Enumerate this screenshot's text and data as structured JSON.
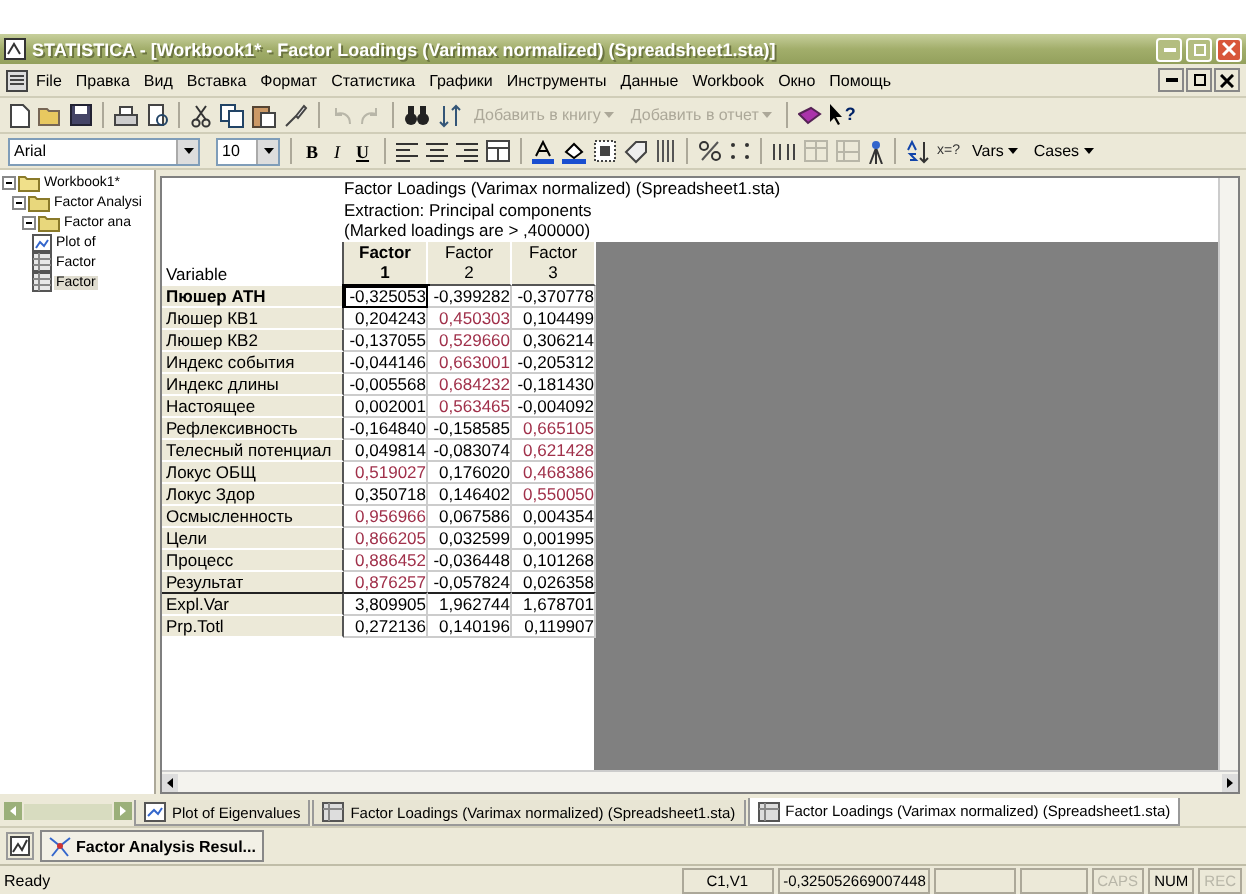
{
  "window": {
    "title": "STATISTICA - [Workbook1* - Factor Loadings (Varimax normalized) (Spreadsheet1.sta)]"
  },
  "menu": [
    "File",
    "Правка",
    "Вид",
    "Вставка",
    "Формат",
    "Статистика",
    "Графики",
    "Инструменты",
    "Данные",
    "Workbook",
    "Окно",
    "Помощь"
  ],
  "toolbar": {
    "undo": {
      "disabled": true
    },
    "redo": {
      "disabled": true
    },
    "add_to_workbook": {
      "label": "Добавить в книгу",
      "disabled": true
    },
    "add_to_report": {
      "label": "Добавить в отчет",
      "disabled": true
    },
    "help_mark": "?"
  },
  "format_bar": {
    "font": "Arial",
    "size": "10",
    "bold": "B",
    "italic": "I",
    "underline": "U",
    "x_label": "x=?",
    "vars": "Vars",
    "cases": "Cases"
  },
  "tree": [
    {
      "label": "Workbook1*",
      "expanded": true,
      "kind": "workbook",
      "selected": false,
      "children": [
        {
          "label": "Factor Analysi",
          "expanded": true,
          "kind": "folder",
          "selected": false,
          "children": [
            {
              "label": "Factor ana",
              "expanded": true,
              "kind": "folder",
              "selected": false,
              "children": [
                {
                  "label": "Plot of",
                  "kind": "graph",
                  "selected": false
                },
                {
                  "label": "Factor",
                  "kind": "sheet",
                  "selected": false
                },
                {
                  "label": "Factor",
                  "kind": "sheet",
                  "selected": true
                }
              ]
            }
          ]
        }
      ]
    }
  ],
  "spreadsheet": {
    "title_lines": [
      "Factor Loadings (Varimax normalized) (Spreadsheet1.sta)",
      "Extraction: Principal components",
      "(Marked loadings are > ,400000)"
    ],
    "row_header_title": "Variable",
    "columns": [
      {
        "name": "Factor",
        "number": "1",
        "selected": true
      },
      {
        "name": "Factor",
        "number": "2",
        "selected": false
      },
      {
        "name": "Factor",
        "number": "3",
        "selected": false
      }
    ],
    "rows": [
      {
        "label": "Пюшер АТН",
        "kind": "data",
        "selected": true,
        "cells": [
          {
            "value": "-0,325053",
            "marked": false
          },
          {
            "value": "-0,399282",
            "marked": false
          },
          {
            "value": "-0,370778",
            "marked": false
          }
        ]
      },
      {
        "label": "Люшер КВ1",
        "kind": "data",
        "selected": false,
        "cells": [
          {
            "value": "0,204243",
            "marked": false
          },
          {
            "value": "0,450303",
            "marked": true
          },
          {
            "value": "0,104499",
            "marked": false
          }
        ]
      },
      {
        "label": "Люшер КВ2",
        "kind": "data",
        "selected": false,
        "cells": [
          {
            "value": "-0,137055",
            "marked": false
          },
          {
            "value": "0,529660",
            "marked": true
          },
          {
            "value": "0,306214",
            "marked": false
          }
        ]
      },
      {
        "label": "Индекс события",
        "kind": "data",
        "selected": false,
        "cells": [
          {
            "value": "-0,044146",
            "marked": false
          },
          {
            "value": "0,663001",
            "marked": true
          },
          {
            "value": "-0,205312",
            "marked": false
          }
        ]
      },
      {
        "label": "Индекс длины",
        "kind": "data",
        "selected": false,
        "cells": [
          {
            "value": "-0,005568",
            "marked": false
          },
          {
            "value": "0,684232",
            "marked": true
          },
          {
            "value": "-0,181430",
            "marked": false
          }
        ]
      },
      {
        "label": "Настоящее",
        "kind": "data",
        "selected": false,
        "cells": [
          {
            "value": "0,002001",
            "marked": false
          },
          {
            "value": "0,563465",
            "marked": true
          },
          {
            "value": "-0,004092",
            "marked": false
          }
        ]
      },
      {
        "label": "Рефлексивность",
        "kind": "data",
        "selected": false,
        "cells": [
          {
            "value": "-0,164840",
            "marked": false
          },
          {
            "value": "-0,158585",
            "marked": false
          },
          {
            "value": "0,665105",
            "marked": true
          }
        ]
      },
      {
        "label": "Телесный потенциал",
        "kind": "data",
        "selected": false,
        "cells": [
          {
            "value": "0,049814",
            "marked": false
          },
          {
            "value": "-0,083074",
            "marked": false
          },
          {
            "value": "0,621428",
            "marked": true
          }
        ]
      },
      {
        "label": "Локус ОБЩ",
        "kind": "data",
        "selected": false,
        "cells": [
          {
            "value": "0,519027",
            "marked": true
          },
          {
            "value": "0,176020",
            "marked": false
          },
          {
            "value": "0,468386",
            "marked": true
          }
        ]
      },
      {
        "label": "Локус Здор",
        "kind": "data",
        "selected": false,
        "cells": [
          {
            "value": "0,350718",
            "marked": false
          },
          {
            "value": "0,146402",
            "marked": false
          },
          {
            "value": "0,550050",
            "marked": true
          }
        ]
      },
      {
        "label": "Осмысленность",
        "kind": "data",
        "selected": false,
        "cells": [
          {
            "value": "0,956966",
            "marked": true
          },
          {
            "value": "0,067586",
            "marked": false
          },
          {
            "value": "0,004354",
            "marked": false
          }
        ]
      },
      {
        "label": "Цели",
        "kind": "data",
        "selected": false,
        "cells": [
          {
            "value": "0,866205",
            "marked": true
          },
          {
            "value": "0,032599",
            "marked": false
          },
          {
            "value": "0,001995",
            "marked": false
          }
        ]
      },
      {
        "label": "Процесс",
        "kind": "data",
        "selected": false,
        "cells": [
          {
            "value": "0,886452",
            "marked": true
          },
          {
            "value": "-0,036448",
            "marked": false
          },
          {
            "value": "0,101268",
            "marked": false
          }
        ]
      },
      {
        "label": "Результат",
        "kind": "data",
        "selected": false,
        "cells": [
          {
            "value": "0,876257",
            "marked": true
          },
          {
            "value": "-0,057824",
            "marked": false
          },
          {
            "value": "0,026358",
            "marked": false
          }
        ]
      },
      {
        "label": "Expl.Var",
        "kind": "summary",
        "selected": false,
        "cells": [
          {
            "value": "3,809905",
            "marked": false
          },
          {
            "value": "1,962744",
            "marked": false
          },
          {
            "value": "1,678701",
            "marked": false
          }
        ]
      },
      {
        "label": "Prp.Totl",
        "kind": "summary",
        "selected": false,
        "cells": [
          {
            "value": "0,272136",
            "marked": false
          },
          {
            "value": "0,140196",
            "marked": false
          },
          {
            "value": "0,119907",
            "marked": false
          }
        ]
      }
    ]
  },
  "tabs": [
    {
      "label": "Plot of Eigenvalues",
      "kind": "graph",
      "selected": false
    },
    {
      "label": "Factor Loadings (Varimax normalized) (Spreadsheet1.sta)",
      "kind": "sheet",
      "selected": false
    },
    {
      "label": "Factor Loadings (Varimax normalized) (Spreadsheet1.sta)",
      "kind": "sheet",
      "selected": true
    }
  ],
  "taskbar": {
    "button": "Factor Analysis Resul..."
  },
  "status_bar": {
    "message": "Ready",
    "cell": "C1,V1",
    "value": "-0,325052669007448",
    "indicators": [
      {
        "label": "CAPS",
        "on": false
      },
      {
        "label": "NUM",
        "on": true
      },
      {
        "label": "REC",
        "on": false
      }
    ]
  }
}
